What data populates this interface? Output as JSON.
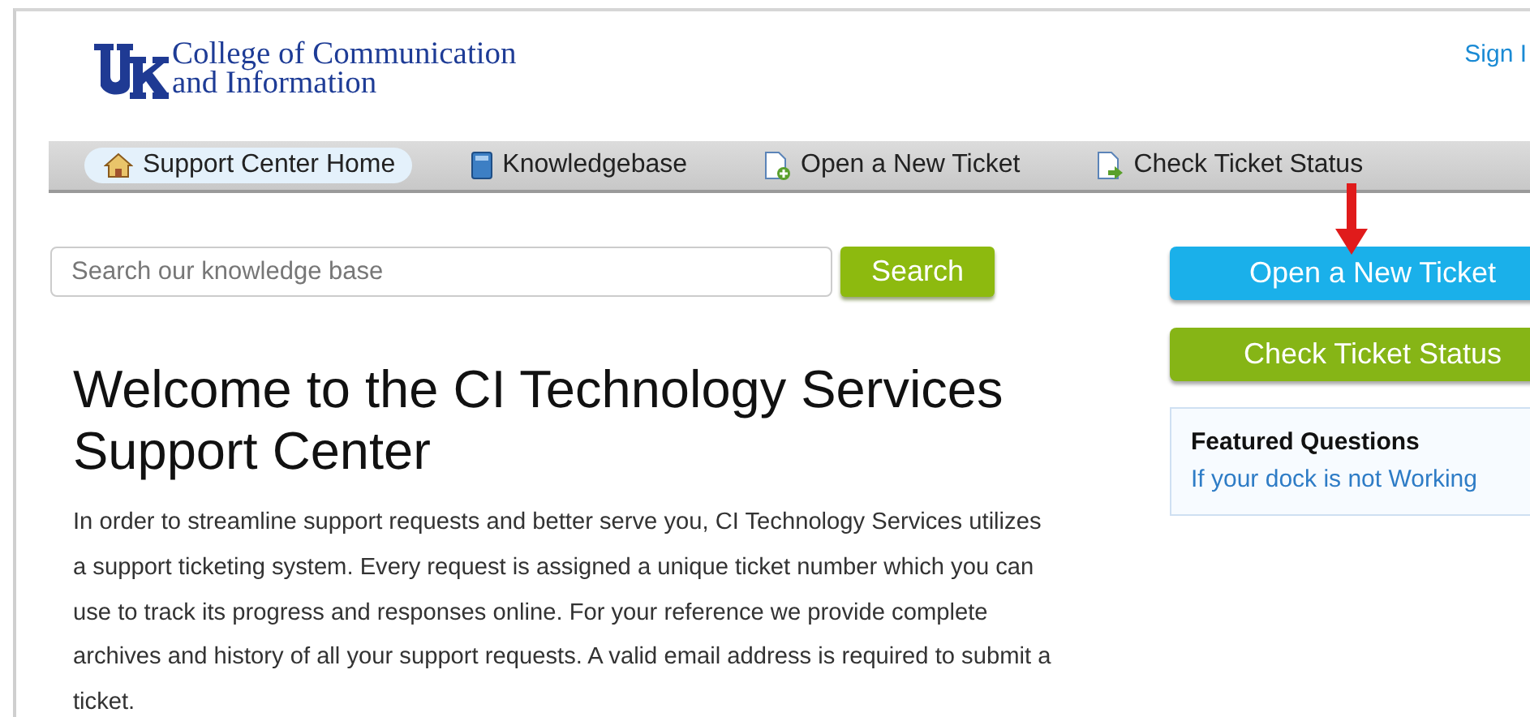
{
  "header": {
    "logo_lines": [
      "College of Communication",
      "and Information"
    ],
    "sign_in": "Sign I"
  },
  "nav": [
    {
      "label": "Support Center Home",
      "kind": "home",
      "selected": true
    },
    {
      "label": "Knowledgebase",
      "kind": "book",
      "selected": false
    },
    {
      "label": "Open a New Ticket",
      "kind": "new-ticket",
      "selected": false
    },
    {
      "label": "Check Ticket Status",
      "kind": "ticket-status",
      "selected": false
    }
  ],
  "search": {
    "placeholder": "Search our knowledge base",
    "button": "Search"
  },
  "welcome": {
    "title": "Welcome to the CI Technology Services Support Center",
    "body": "In order to streamline support requests and better serve you, CI Technology Services utilizes a support ticketing system. Every request is assigned a unique ticket number which you can use to track its progress and responses online. For your reference we provide complete archives and history of all your support requests. A valid email address is required to submit a ticket."
  },
  "sidebar": {
    "buttons": [
      {
        "label": "Open a New Ticket",
        "kind": "primary"
      },
      {
        "label": "Check Ticket Status",
        "kind": "secondary"
      }
    ],
    "featured": {
      "title": "Featured Questions",
      "links": [
        "If your dock is not Working"
      ]
    }
  }
}
